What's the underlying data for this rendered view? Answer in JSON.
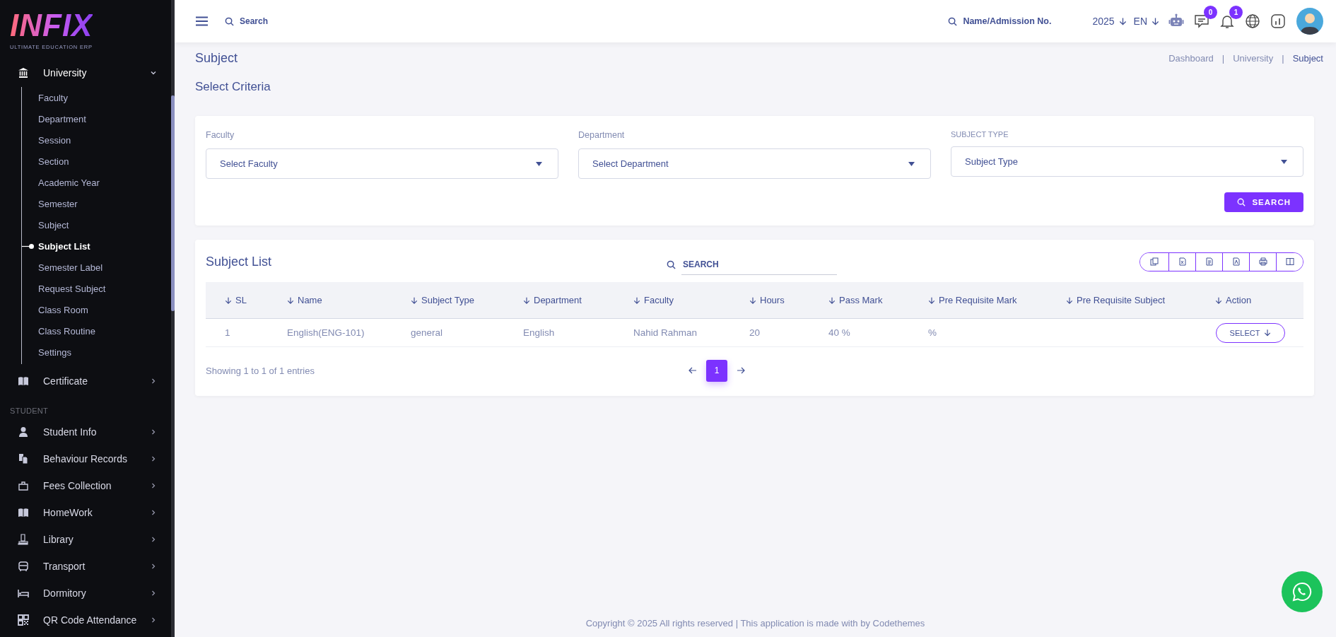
{
  "sidebar": {
    "logo": {
      "wordmark": "INFIX",
      "tagline": "ULTIMATE EDUCATION ERP"
    },
    "menu": [
      {
        "label": "University",
        "expanded": true,
        "children": [
          {
            "label": "Faculty",
            "selected": false
          },
          {
            "label": "Department",
            "selected": false
          },
          {
            "label": "Session",
            "selected": false
          },
          {
            "label": "Section",
            "selected": false
          },
          {
            "label": "Academic Year",
            "selected": false
          },
          {
            "label": "Semester",
            "selected": false
          },
          {
            "label": "Subject",
            "selected": false
          },
          {
            "label": "Subject List",
            "selected": true
          },
          {
            "label": "Semester Label",
            "selected": false
          },
          {
            "label": "Request Subject",
            "selected": false
          },
          {
            "label": "Class Room",
            "selected": false
          },
          {
            "label": "Class Routine",
            "selected": false
          },
          {
            "label": "Settings",
            "selected": false
          }
        ]
      },
      {
        "label": "Certificate",
        "expanded": false
      }
    ],
    "student_section": {
      "heading": "STUDENT",
      "items": [
        {
          "label": "Student Info",
          "expanded": false
        },
        {
          "label": "Behaviour Records",
          "expanded": false
        },
        {
          "label": "Fees Collection",
          "expanded": false
        },
        {
          "label": "HomeWork",
          "expanded": false
        },
        {
          "label": "Library",
          "expanded": false
        },
        {
          "label": "Transport",
          "expanded": false
        },
        {
          "label": "Dormitory",
          "expanded": false
        },
        {
          "label": "QR Code Attendance",
          "expanded": false
        }
      ]
    }
  },
  "header": {
    "search": {
      "placeholder": "Search"
    },
    "lookup": {
      "placeholder": "Name/Admission No."
    },
    "year": "2025",
    "language": "EN",
    "chat_badge": "0",
    "notification_badge": "1"
  },
  "page": {
    "title": "Subject",
    "breadcrumb": [
      {
        "label": "Dashboard",
        "selected": false
      },
      {
        "label": "University",
        "selected": false
      },
      {
        "label": "Subject",
        "selected": true
      }
    ],
    "separator": "|"
  },
  "criteria": {
    "heading": "Select Criteria",
    "fields": [
      {
        "label": "Faculty",
        "placeholder": "Select Faculty"
      },
      {
        "label": "Department",
        "placeholder": "Select Department"
      },
      {
        "label": "SUBJECT TYPE",
        "placeholder": "Subject Type"
      }
    ],
    "button": "SEARCH"
  },
  "subject_list": {
    "title": "Subject List",
    "search": {
      "placeholder": "SEARCH"
    },
    "table": {
      "columns": [
        "SL",
        "Name",
        "Subject Type",
        "Department",
        "Faculty",
        "Hours",
        "Pass Mark",
        "Pre Requisite Mark",
        "Pre Requisite Subject",
        "Action"
      ],
      "rows": [
        {
          "cells": [
            "1",
            "English(ENG-101)",
            "general",
            "English",
            "Nahid Rahman",
            "20",
            "40 %",
            "%",
            ""
          ],
          "action": "SELECT"
        }
      ]
    },
    "info": "Showing 1 to 1 of 1 entries",
    "pages": [
      {
        "label": "1",
        "selected": true
      }
    ]
  },
  "footer": "Copyright © 2025 All rights reserved | This application is made with by Codethemes"
}
